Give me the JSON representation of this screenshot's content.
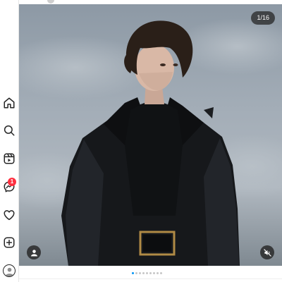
{
  "nav": {
    "items": [
      {
        "name": "home",
        "icon": "home-icon"
      },
      {
        "name": "search",
        "icon": "search-icon"
      },
      {
        "name": "reels",
        "icon": "reels-icon"
      },
      {
        "name": "messages",
        "icon": "messenger-icon",
        "badge": "1"
      },
      {
        "name": "notifications",
        "icon": "heart-icon"
      },
      {
        "name": "create",
        "icon": "plus-square-icon"
      },
      {
        "name": "profile",
        "icon": "profile-avatar-icon"
      }
    ]
  },
  "post": {
    "counter": "1/16",
    "tag_icon": "user-tag-icon",
    "mute_icon": "speaker-muted-icon",
    "carousel": {
      "total_dots": 9,
      "active_index": 0
    }
  },
  "colors": {
    "accent": "#0095f6",
    "badge": "#ff3040",
    "overlay": "#262626"
  }
}
